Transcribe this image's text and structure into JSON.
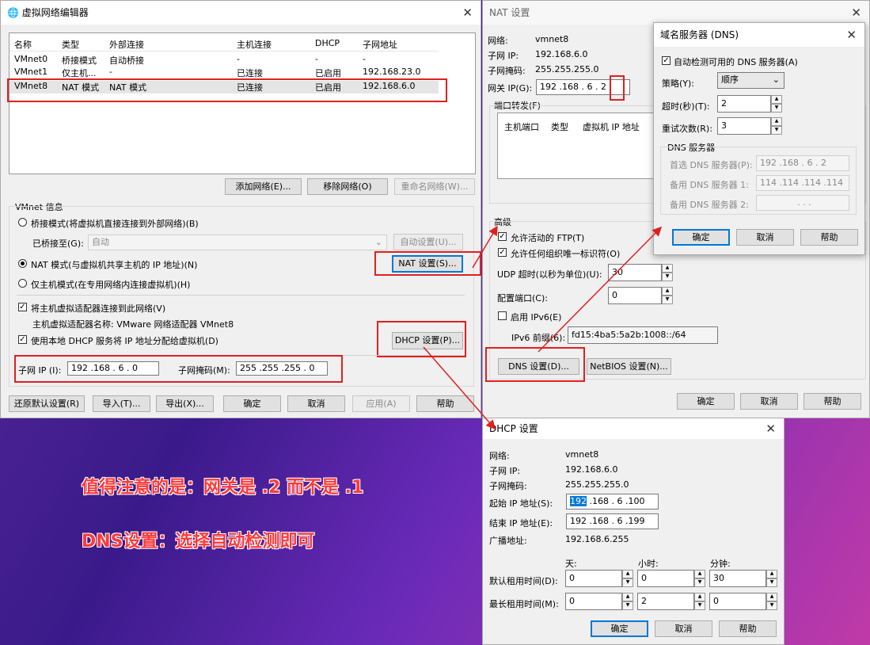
{
  "vne": {
    "title": "虚拟网络编辑器",
    "headers": [
      "名称",
      "类型",
      "外部连接",
      "主机连接",
      "DHCP",
      "子网地址"
    ],
    "rows": [
      [
        "VMnet0",
        "桥接模式",
        "自动桥接",
        "-",
        "-",
        "-"
      ],
      [
        "VMnet1",
        "仅主机...",
        "-",
        "已连接",
        "已启用",
        "192.168.23.0"
      ],
      [
        "VMnet8",
        "NAT 模式",
        "NAT 模式",
        "已连接",
        "已启用",
        "192.168.6.0"
      ]
    ],
    "add": "添加网络(E)...",
    "remove": "移除网络(O)",
    "rename": "重命名网络(W)...",
    "info": "VMnet 信息",
    "bridge": "桥接模式(将虚拟机直接连接到外部网络)(B)",
    "bridged_to": "已桥接至(G):",
    "bridged_val": "自动",
    "auto": "自动设置(U)...",
    "nat": "NAT 模式(与虚拟机共享主机的 IP 地址)(N)",
    "nat_btn": "NAT 设置(S)...",
    "host": "仅主机模式(在专用网络内连接虚拟机)(H)",
    "connect": "将主机虚拟适配器连接到此网络(V)",
    "adapter": "主机虚拟适配器名称: VMware 网络适配器 VMnet8",
    "dhcp": "使用本地 DHCP 服务将 IP 地址分配给虚拟机(D)",
    "dhcp_btn": "DHCP 设置(P)...",
    "subnet_ip": "子网 IP (I):",
    "subnet_ip_val": "192 .168 . 6 . 0",
    "mask": "子网掩码(M):",
    "mask_val": "255 .255 .255 . 0",
    "restore": "还原默认设置(R)",
    "import": "导入(T)...",
    "export": "导出(X)...",
    "ok": "确定",
    "cancel": "取消",
    "apply": "应用(A)",
    "help": "帮助"
  },
  "nat": {
    "title": "NAT 设置",
    "net_l": "网络:",
    "net": "vmnet8",
    "sip_l": "子网 IP:",
    "sip": "192.168.6.0",
    "mask_l": "子网掩码:",
    "mask": "255.255.255.0",
    "gw_l": "网关 IP(G):",
    "gw": "192 .168 . 6 .",
    "gw_last": "2",
    "pf": "端口转发(F)",
    "pf_h": [
      "主机端口",
      "类型",
      "虚拟机 IP 地址"
    ],
    "adv": "高级",
    "ftp": "允许活动的 FTP(T)",
    "oui": "允许任何组织唯一标识符(O)",
    "udp": "UDP 超时(以秒为单位)(U):",
    "udp_v": "30",
    "port": "配置端口(C):",
    "port_v": "0",
    "ipv6": "启用 IPv6(E)",
    "ipv6_p": "IPv6 前缀(6):",
    "ipv6_v": "fd15:4ba5:5a2b:1008::/64",
    "dns": "DNS 设置(D)...",
    "netbios": "NetBIOS 设置(N)...",
    "ok": "确定",
    "cancel": "取消",
    "help": "帮助"
  },
  "dns": {
    "title": "域名服务器 (DNS)",
    "auto": "自动检测可用的 DNS 服务器(A)",
    "policy": "策略(Y):",
    "policy_v": "顺序",
    "timeout": "超时(秒)(T):",
    "timeout_v": "2",
    "retry": "重试次数(R):",
    "retry_v": "3",
    "grp": "DNS 服务器",
    "p1": "首选 DNS 服务器(P):",
    "p1v": "192 .168 . 6 . 2",
    "p2": "备用 DNS 服务器 1:",
    "p2v": "114 .114 .114 .114",
    "p3": "备用 DNS 服务器 2:",
    "p3v": ".     .     .",
    "ok": "确定",
    "cancel": "取消",
    "help": "帮助"
  },
  "dhcp": {
    "title": "DHCP 设置",
    "net_l": "网络:",
    "net": "vmnet8",
    "sip_l": "子网 IP:",
    "sip": "192.168.6.0",
    "mask_l": "子网掩码:",
    "mask": "255.255.255.0",
    "start_l": "起始 IP 地址(S):",
    "start_sel": "192",
    "start_rest": " .168 . 6 .100",
    "end_l": "结束 IP 地址(E):",
    "end": "192 .168 . 6 .199",
    "bc_l": "广播地址:",
    "bc": "192.168.6.255",
    "day": "天:",
    "hour": "小时:",
    "min": "分钟:",
    "def_l": "默认租用时间(D):",
    "def": [
      "0",
      "0",
      "30"
    ],
    "max_l": "最长租用时间(M):",
    "max": [
      "0",
      "2",
      "0"
    ],
    "ok": "确定",
    "cancel": "取消",
    "help": "帮助"
  },
  "notes": [
    "值得注意的是：网关是 .2 而不是 .1",
    "DNS设置：选择自动检测即可"
  ],
  "colors": {
    "annotation": "#ff3a3a",
    "highlight": "#e02020",
    "accent": "#0078d7"
  }
}
